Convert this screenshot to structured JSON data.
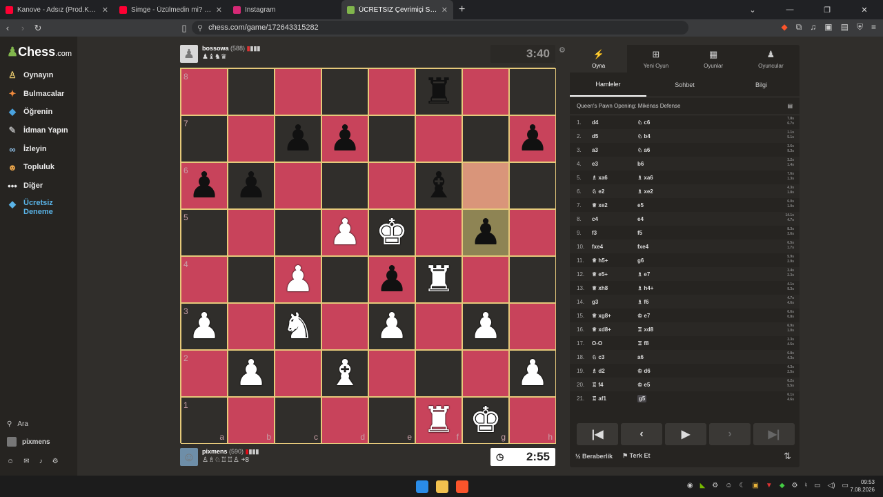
{
  "browser": {
    "tabs": [
      {
        "title": "Kanove - Adsız (Prod.Kanove) - YouTube",
        "color": "#ff0033"
      },
      {
        "title": "Simge - Üzülmedin mi? - YouTube",
        "color": "#ff0033"
      },
      {
        "title": "Instagram",
        "color": "#d62976"
      },
      {
        "title": "ÜCRETSİZ Çevrimiçi Satranç Oyna",
        "color": "#81b64c",
        "active": true
      }
    ],
    "new_tab": "+",
    "url": "chess.com/game/172643315282"
  },
  "sidebar": {
    "logo": "Chess",
    "logo_suffix": ".com",
    "items": [
      {
        "label": "Oynayın",
        "icon": "play-icon"
      },
      {
        "label": "Bulmacalar",
        "icon": "puzzle-icon"
      },
      {
        "label": "Öğrenin",
        "icon": "learn-icon"
      },
      {
        "label": "İdman Yapın",
        "icon": "train-icon"
      },
      {
        "label": "İzleyin",
        "icon": "watch-icon"
      },
      {
        "label": "Topluluk",
        "icon": "community-icon"
      },
      {
        "label": "Diğer",
        "icon": "more-icon"
      },
      {
        "label": "Ücretsiz Deneme",
        "icon": "diamond-icon"
      }
    ],
    "search": "Ara",
    "user": "pixmens"
  },
  "game": {
    "top_player": {
      "name": "bossowa",
      "rating": "(588)",
      "captured": "♟♝♞♛"
    },
    "bottom_player": {
      "name": "pixmens",
      "rating": "(590)",
      "captured": "♙♗♘♖♖♙",
      "advantage": "+8"
    },
    "top_clock": "3:40",
    "bottom_clock": "2:55",
    "ranks": [
      "8",
      "7",
      "6",
      "5",
      "4",
      "3",
      "2",
      "1"
    ],
    "files": [
      "a",
      "b",
      "c",
      "d",
      "e",
      "f",
      "g",
      "h"
    ]
  },
  "panel": {
    "tabs": [
      {
        "label": "Oyna",
        "icon": "bolt-icon"
      },
      {
        "label": "Yeni Oyun",
        "icon": "plus-icon"
      },
      {
        "label": "Oyunlar",
        "icon": "board-icon"
      },
      {
        "label": "Oyuncular",
        "icon": "players-icon"
      }
    ],
    "subtabs": [
      "Hamleler",
      "Sohbet",
      "Bilgi"
    ],
    "opening": "Queen's Pawn Opening: Mikėnas Defense",
    "moves": [
      {
        "n": "1.",
        "w": "d4",
        "b": "♘ c6",
        "tw": "7.8s",
        "tb": "6.7s"
      },
      {
        "n": "2.",
        "w": "d5",
        "b": "♘ b4",
        "tw": "1.1s",
        "tb": "5.1s"
      },
      {
        "n": "3.",
        "w": "a3",
        "b": "♘ a6",
        "tw": "3.6s",
        "tb": "9.3s"
      },
      {
        "n": "4.",
        "w": "e3",
        "b": "b6",
        "tw": "3.2s",
        "tb": "1.4s"
      },
      {
        "n": "5.",
        "w": "♗ xa6",
        "b": "♗ xa6",
        "tw": "7.6s",
        "tb": "1.3s"
      },
      {
        "n": "6.",
        "w": "♘ e2",
        "b": "♗ xe2",
        "tw": "4.3s",
        "tb": "1.8s"
      },
      {
        "n": "7.",
        "w": "♕ xe2",
        "b": "e5",
        "tw": "6.0s",
        "tb": "1.0s"
      },
      {
        "n": "8.",
        "w": "c4",
        "b": "e4",
        "tw": "14.1s",
        "tb": "4.7s"
      },
      {
        "n": "9.",
        "w": "f3",
        "b": "f5",
        "tw": "8.3s",
        "tb": "3.6s"
      },
      {
        "n": "10.",
        "w": "fxe4",
        "b": "fxe4",
        "tw": "6.5s",
        "tb": "1.7s"
      },
      {
        "n": "11.",
        "w": "♕ h5+",
        "b": "g6",
        "tw": "5.9s",
        "tb": "2.9s"
      },
      {
        "n": "12.",
        "w": "♕ e5+",
        "b": "♗ e7",
        "tw": "3.4s",
        "tb": "2.3s"
      },
      {
        "n": "13.",
        "w": "♕ xh8",
        "b": "♗ h4+",
        "tw": "4.1s",
        "tb": "9.3s"
      },
      {
        "n": "14.",
        "w": "g3",
        "b": "♗ f6",
        "tw": "4.7s",
        "tb": "4.6s"
      },
      {
        "n": "15.",
        "w": "♕ xg8+",
        "b": "♔ e7",
        "tw": "6.6s",
        "tb": "0.8s"
      },
      {
        "n": "16.",
        "w": "♕ xd8+",
        "b": "♖ xd8",
        "tw": "6.9s",
        "tb": "1.0s"
      },
      {
        "n": "17.",
        "w": "O-O",
        "b": "♖ f8",
        "tw": "3.3s",
        "tb": "4.5s"
      },
      {
        "n": "18.",
        "w": "♘ c3",
        "b": "a6",
        "tw": "6.8s",
        "tb": "4.3s"
      },
      {
        "n": "19.",
        "w": "♗ d2",
        "b": "♔ d6",
        "tw": "4.3s",
        "tb": "2.5s"
      },
      {
        "n": "20.",
        "w": "♖ f4",
        "b": "♔ e5",
        "tw": "6.2s",
        "tb": "5.5s"
      },
      {
        "n": "21.",
        "w": "♖ af1",
        "b": "g5",
        "tw": "6.1s",
        "tb": "4.6s"
      }
    ],
    "draw": "Beraberlik",
    "resign": "Terk Et",
    "draw_icon": "½"
  },
  "taskbar": {
    "time": "09:53",
    "date": "7.08.2026"
  }
}
